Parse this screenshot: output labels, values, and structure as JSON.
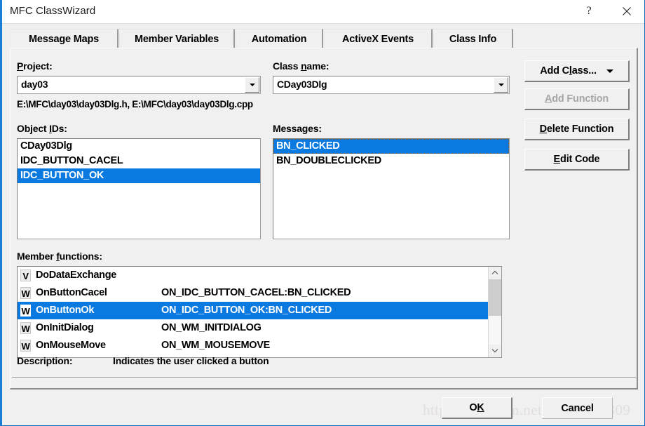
{
  "window": {
    "title": "MFC ClassWizard",
    "help_glyph": "?",
    "close_icon": "close-icon"
  },
  "tabs": [
    {
      "label": "Message Maps",
      "active": true
    },
    {
      "label": "Member Variables",
      "active": false
    },
    {
      "label": "Automation",
      "active": false
    },
    {
      "label": "ActiveX Events",
      "active": false
    },
    {
      "label": "Class Info",
      "active": false
    }
  ],
  "project": {
    "label_prefix": "",
    "label": "Project:",
    "label_pre": "P",
    "label_post": "roject:",
    "value": "day03"
  },
  "class_name": {
    "label_pre": "Class ",
    "label_mid": "n",
    "label_post": "ame:",
    "value": "CDay03Dlg"
  },
  "file_paths": "E:\\MFC\\day03\\day03Dlg.h, E:\\MFC\\day03\\day03Dlg.cpp",
  "object_ids": {
    "label_pre": "Object ",
    "label_mid": "I",
    "label_post": "Ds:",
    "items": [
      {
        "label": "CDay03Dlg",
        "selected": false
      },
      {
        "label": "IDC_BUTTON_CACEL",
        "selected": false
      },
      {
        "label": "IDC_BUTTON_OK",
        "selected": true
      }
    ]
  },
  "messages": {
    "label": "Messages:",
    "items": [
      {
        "label": "BN_CLICKED",
        "selected": true,
        "focused": true
      },
      {
        "label": "BN_DOUBLECLICKED",
        "selected": false,
        "focused": false
      }
    ]
  },
  "member_functions": {
    "label_pre": "Member ",
    "label_mid": "f",
    "label_post": "unctions:",
    "items": [
      {
        "mark": "V",
        "name": "DoDataExchange",
        "message": "",
        "selected": false
      },
      {
        "mark": "W",
        "name": "OnButtonCacel",
        "message": "ON_IDC_BUTTON_CACEL:BN_CLICKED",
        "selected": false
      },
      {
        "mark": "W",
        "name": "OnButtonOk",
        "message": "ON_IDC_BUTTON_OK:BN_CLICKED",
        "selected": true
      },
      {
        "mark": "W",
        "name": "OnInitDialog",
        "message": "ON_WM_INITDIALOG",
        "selected": false
      },
      {
        "mark": "W",
        "name": "OnMouseMove",
        "message": "ON_WM_MOUSEMOVE",
        "selected": false
      }
    ],
    "scrollbar": {
      "up_icon": "chevron-up-icon",
      "down_icon": "chevron-down-icon"
    }
  },
  "description": {
    "label": "Description:",
    "text": "Indicates the user clicked a button"
  },
  "side_buttons": [
    {
      "pre": "Add C",
      "mid": "l",
      "post": "ass...",
      "dropdown": true,
      "disabled": false
    },
    {
      "pre": "",
      "mid": "A",
      "post": "dd Function",
      "dropdown": false,
      "disabled": true
    },
    {
      "pre": "",
      "mid": "D",
      "post": "elete Function",
      "dropdown": false,
      "disabled": false
    },
    {
      "pre": "",
      "mid": "E",
      "post": "dit Code",
      "dropdown": false,
      "disabled": false
    }
  ],
  "bottom_buttons": {
    "ok_pre": "O",
    "ok_mid": "K",
    "ok_post": "",
    "ok": "OK",
    "cancel": "Cancel"
  },
  "watermark": "http://blog.csdn.net/qq_28019309",
  "colors": {
    "selection": "#0a7ae0",
    "face": "#f0f0f0",
    "window_border": "#1a7fd4"
  }
}
